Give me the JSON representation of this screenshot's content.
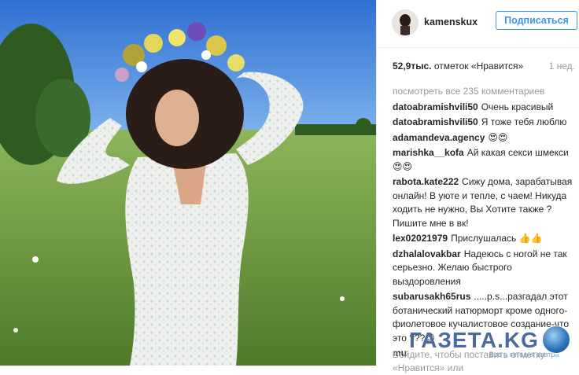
{
  "post": {
    "username": "kamenskux",
    "follow_label": "Подписаться",
    "likes_count": "52,9тыс.",
    "likes_text": "отметок «Нравится»",
    "time": "1 нед."
  },
  "comments": {
    "more_label": "посмотреть все 235 комментариев",
    "items": [
      {
        "user": "datoabramishvili50",
        "text": "Очень красивый"
      },
      {
        "user": "datoabramishvili50",
        "text": "Я тоже тебя люблю"
      },
      {
        "user": "adamandeva.agency",
        "text": "😍😍"
      },
      {
        "user": "marishka__kofa",
        "text": "Ай какая секси шмекси😍😍"
      },
      {
        "user": "rabota.kate222",
        "text": "Сижу дома, зарабатывая онлайн! В уюте и тепле, с чаем! Никуда ходить не нужно, Вы Хотите также ? Пишите мне в вк!"
      },
      {
        "user": "lex02021979",
        "text": "Прислушалась 👍👍"
      },
      {
        "user": "dzhalalovakbar",
        "text": "Надеюсь с ногой не так серьезно. Желаю быстрого выздоровления"
      },
      {
        "user": "subarusakh65rus",
        "text": ".....p.s...разгадал этот ботанический натюрморт кроме одного-фиолетовое кучалистовое создание-что это ???😊"
      },
      {
        "user": "mu",
        "text": ""
      }
    ]
  },
  "footer": {
    "text": "Войдите, чтобы поставить отметку «Нравится» или"
  },
  "watermark": {
    "brand": "ГАЗЕТА.KG",
    "tagline": "Все о сегодня завтра"
  },
  "colors": {
    "accent": "#3897f0",
    "meta_gray": "#999999",
    "text": "#262626",
    "sky": "#3f7fd6",
    "grass": "#6f9a3c"
  }
}
